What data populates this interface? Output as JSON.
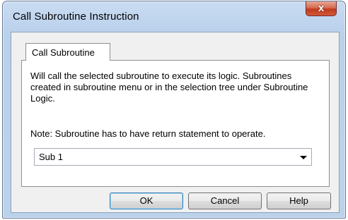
{
  "window": {
    "title": "Call Subroutine Instruction",
    "close_label": "x"
  },
  "tabs": [
    {
      "label": "Call Subroutine",
      "selected": true
    }
  ],
  "panel": {
    "description": "Will call the selected subroutine to execute its logic. Subroutines created in subroutine menu or in the selection tree under Subroutine Logic.",
    "note": "Note: Subroutine has to have return statement to operate.",
    "subroutine_select": {
      "value": "Sub 1"
    }
  },
  "buttons": {
    "ok": "OK",
    "cancel": "Cancel",
    "help": "Help"
  },
  "colors": {
    "frame": "#bcd2eb",
    "close_button": "#c2391d",
    "client_bg": "#f0f0f0",
    "default_button_border": "#3c7fb1"
  }
}
